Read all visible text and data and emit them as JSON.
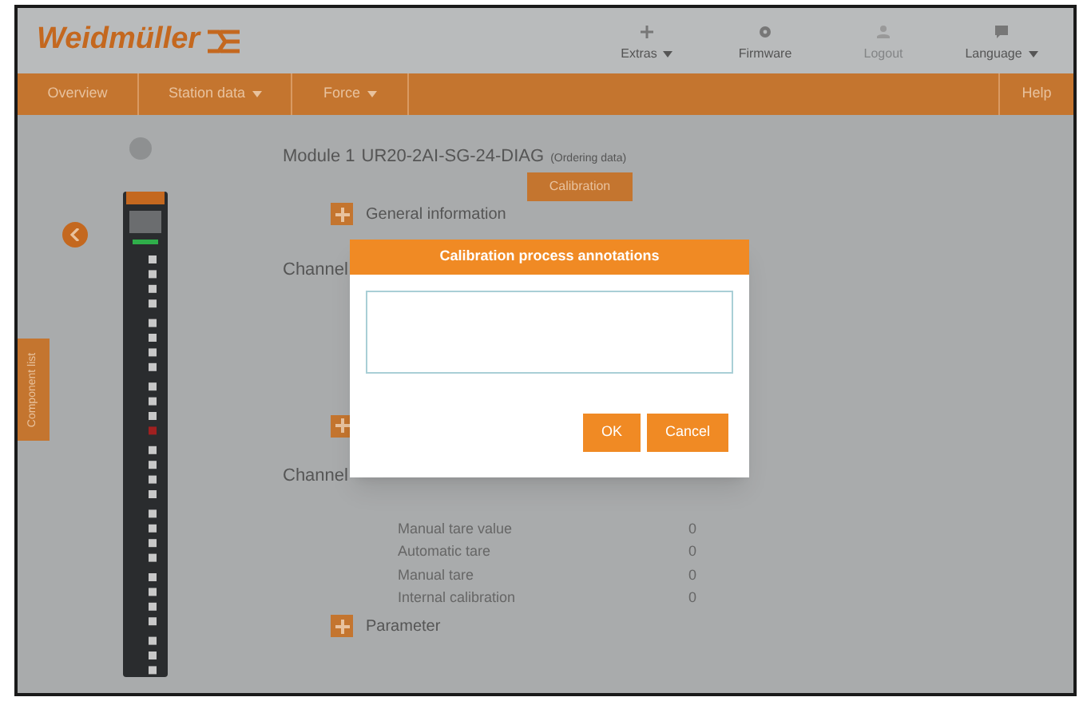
{
  "header": {
    "logo": "Weidmüller",
    "tools": [
      {
        "label": "Extras",
        "dropdown": true,
        "disabled": false
      },
      {
        "label": "Firmware",
        "dropdown": false,
        "disabled": false
      },
      {
        "label": "Logout",
        "dropdown": false,
        "disabled": true
      },
      {
        "label": "Language",
        "dropdown": true,
        "disabled": false
      }
    ]
  },
  "nav": {
    "items": [
      {
        "label": "Overview",
        "dropdown": false
      },
      {
        "label": "Station data",
        "dropdown": true
      },
      {
        "label": "Force",
        "dropdown": true
      }
    ],
    "help": "Help"
  },
  "side_tab": "Component list",
  "module": {
    "title": "Module 1",
    "name": "UR20-2AI-SG-24-DIAG",
    "ordering": "(Ordering data)",
    "calibration_button": "Calibration"
  },
  "sections": [
    {
      "kind": "expander",
      "label": "General information"
    },
    {
      "kind": "heading",
      "label": "Channel"
    },
    {
      "kind": "expander"
    },
    {
      "kind": "heading",
      "label": "Channel"
    },
    {
      "kind": "row",
      "label": "Manual tare value",
      "value": "0"
    },
    {
      "kind": "row",
      "label": "Automatic tare",
      "value": "0"
    },
    {
      "kind": "row",
      "label": "Manual tare",
      "value": "0"
    },
    {
      "kind": "row",
      "label": "Internal calibration",
      "value": "0"
    },
    {
      "kind": "expander",
      "label": "Parameter"
    }
  ],
  "dialog": {
    "title": "Calibration process annotations",
    "buttons": [
      "OK",
      "Cancel"
    ]
  }
}
